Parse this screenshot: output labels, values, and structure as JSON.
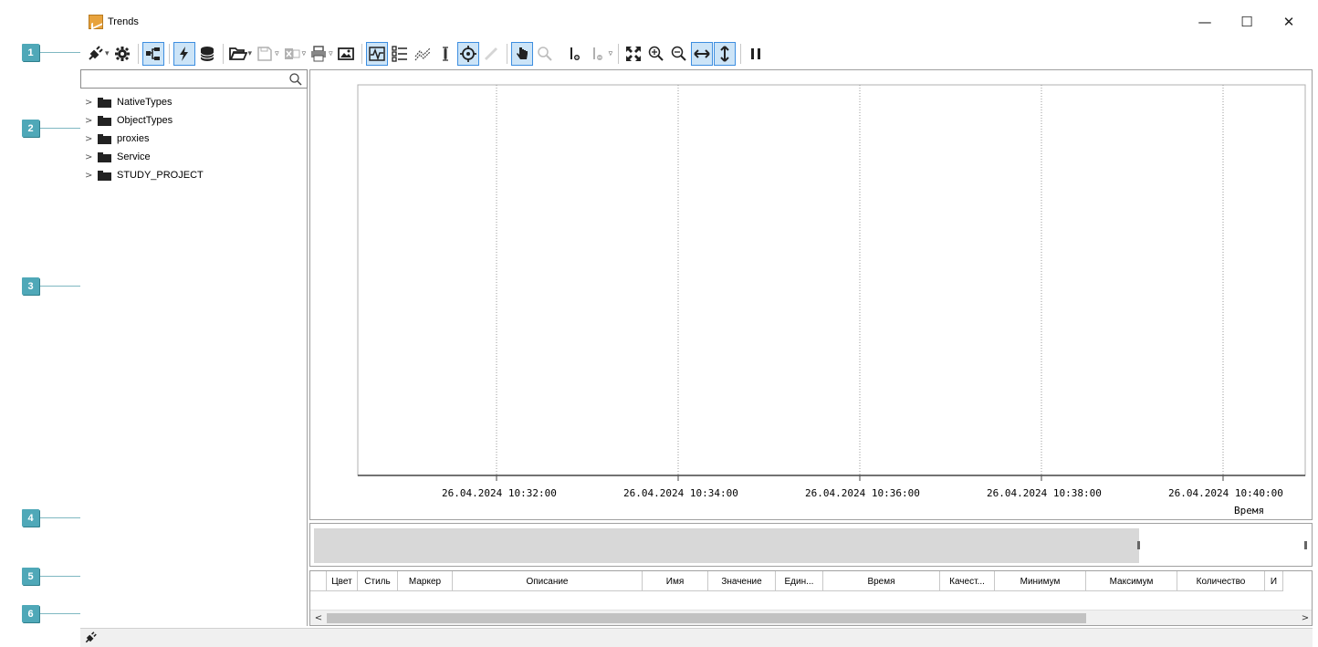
{
  "window": {
    "title": "Trends"
  },
  "window_controls": {
    "minimize": "—",
    "maximize": "☐",
    "close": "✕"
  },
  "callouts": [
    "1",
    "2",
    "3",
    "4",
    "5",
    "6"
  ],
  "search": {
    "value": "",
    "placeholder": ""
  },
  "tree": [
    {
      "label": "NativeTypes"
    },
    {
      "label": "ObjectTypes"
    },
    {
      "label": "proxies"
    },
    {
      "label": "Service"
    },
    {
      "label": "STUDY_PROJECT"
    }
  ],
  "chart_data": {
    "type": "line",
    "series": [],
    "xticks": [
      "26.04.2024 10:32:00",
      "26.04.2024 10:34:00",
      "26.04.2024 10:36:00",
      "26.04.2024 10:38:00",
      "26.04.2024 10:40:00"
    ],
    "xlabel": "Время",
    "ylabel": "",
    "grid": true
  },
  "table": {
    "columns": [
      "",
      "Цвет",
      "Стиль",
      "Маркер",
      "Описание",
      "Имя",
      "Значение",
      "Един...",
      "Время",
      "Качест...",
      "Минимум",
      "Максимум",
      "Количество",
      "И"
    ],
    "rows": []
  },
  "scroll": {
    "left": "<",
    "right": ">"
  }
}
